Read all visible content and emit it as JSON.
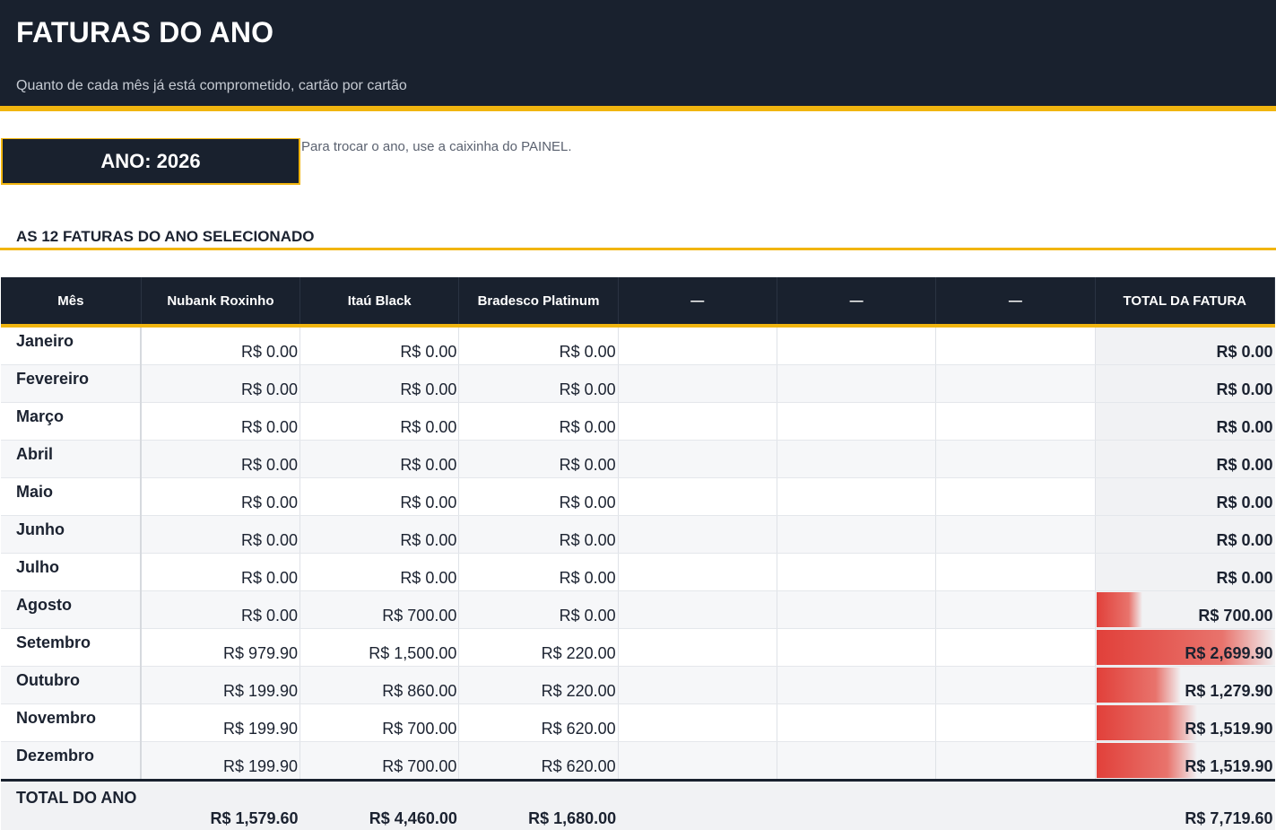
{
  "header": {
    "title": "FATURAS DO ANO",
    "subtitle": "Quanto de cada mês já está comprometido, cartão por cartão"
  },
  "year_selector": {
    "label": "ANO: 2026",
    "hint": "Para trocar o ano, use a caixinha do PAINEL."
  },
  "section_title": "AS 12 FATURAS DO ANO SELECIONADO",
  "table": {
    "headers": [
      "Mês",
      "Nubank Roxinho",
      "Itaú Black",
      "Bradesco Platinum",
      "—",
      "—",
      "—",
      "TOTAL DA FATURA"
    ],
    "rows": [
      {
        "month": "Janeiro",
        "nubank": "R$ 0.00",
        "itau": "R$ 0.00",
        "bradesco": "R$ 0.00",
        "total": "R$ 0.00",
        "total_value": 0
      },
      {
        "month": "Fevereiro",
        "nubank": "R$ 0.00",
        "itau": "R$ 0.00",
        "bradesco": "R$ 0.00",
        "total": "R$ 0.00",
        "total_value": 0
      },
      {
        "month": "Março",
        "nubank": "R$ 0.00",
        "itau": "R$ 0.00",
        "bradesco": "R$ 0.00",
        "total": "R$ 0.00",
        "total_value": 0
      },
      {
        "month": "Abril",
        "nubank": "R$ 0.00",
        "itau": "R$ 0.00",
        "bradesco": "R$ 0.00",
        "total": "R$ 0.00",
        "total_value": 0
      },
      {
        "month": "Maio",
        "nubank": "R$ 0.00",
        "itau": "R$ 0.00",
        "bradesco": "R$ 0.00",
        "total": "R$ 0.00",
        "total_value": 0
      },
      {
        "month": "Junho",
        "nubank": "R$ 0.00",
        "itau": "R$ 0.00",
        "bradesco": "R$ 0.00",
        "total": "R$ 0.00",
        "total_value": 0
      },
      {
        "month": "Julho",
        "nubank": "R$ 0.00",
        "itau": "R$ 0.00",
        "bradesco": "R$ 0.00",
        "total": "R$ 0.00",
        "total_value": 0
      },
      {
        "month": "Agosto",
        "nubank": "R$ 0.00",
        "itau": "R$ 700.00",
        "bradesco": "R$ 0.00",
        "total": "R$ 700.00",
        "total_value": 700.0
      },
      {
        "month": "Setembro",
        "nubank": "R$ 979.90",
        "itau": "R$ 1,500.00",
        "bradesco": "R$ 220.00",
        "total": "R$ 2,699.90",
        "total_value": 2699.9
      },
      {
        "month": "Outubro",
        "nubank": "R$ 199.90",
        "itau": "R$ 860.00",
        "bradesco": "R$ 220.00",
        "total": "R$ 1,279.90",
        "total_value": 1279.9
      },
      {
        "month": "Novembro",
        "nubank": "R$ 199.90",
        "itau": "R$ 700.00",
        "bradesco": "R$ 620.00",
        "total": "R$ 1,519.90",
        "total_value": 1519.9
      },
      {
        "month": "Dezembro",
        "nubank": "R$ 199.90",
        "itau": "R$ 700.00",
        "bradesco": "R$ 620.00",
        "total": "R$ 1,519.90",
        "total_value": 1519.9
      }
    ],
    "footer": {
      "label": "TOTAL DO ANO",
      "nubank": "R$ 1,579.60",
      "itau": "R$ 4,460.00",
      "bradesco": "R$ 1,680.00",
      "total": "R$ 7,719.60"
    }
  },
  "colors": {
    "header_bg": "#19212e",
    "accent": "#f1b50f",
    "databar": "#e1403a"
  }
}
